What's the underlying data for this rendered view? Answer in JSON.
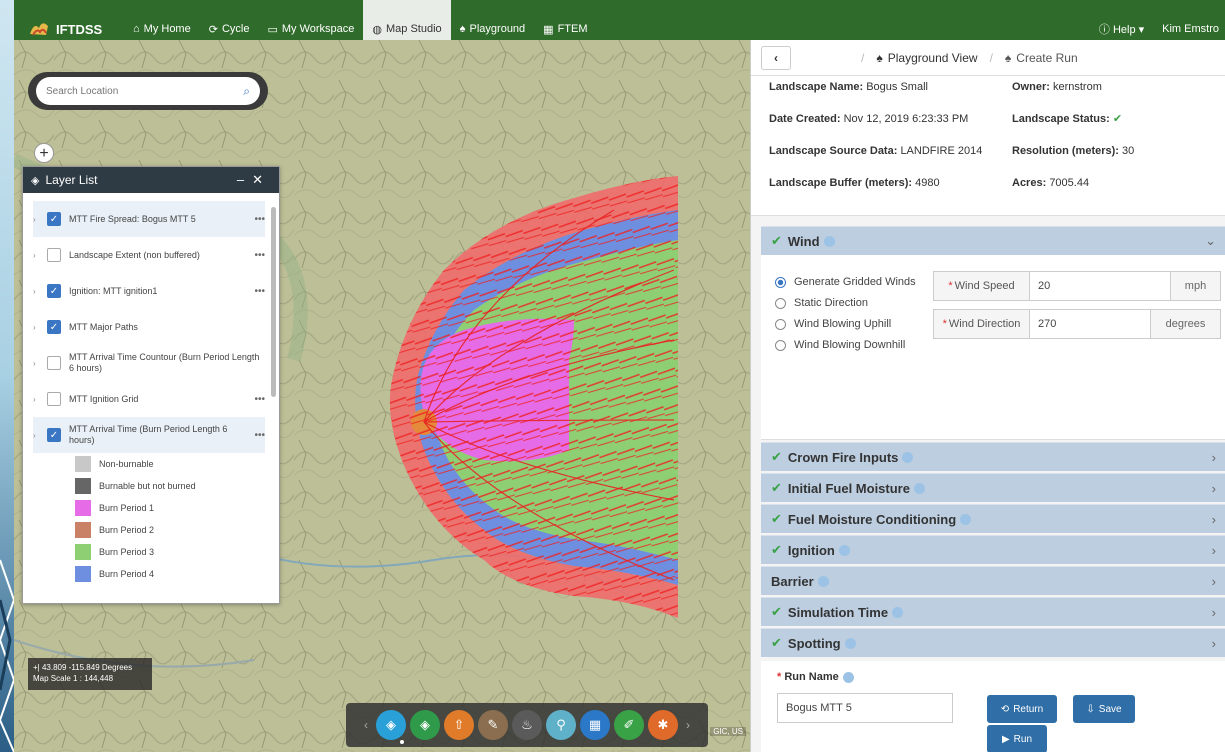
{
  "nav": {
    "brand": "IFTDSS",
    "items": [
      {
        "label": "My Home",
        "icon": "home-icon",
        "glyph": "⌂"
      },
      {
        "label": "Cycle",
        "icon": "cycle-icon",
        "glyph": "⟳"
      },
      {
        "label": "My Workspace",
        "icon": "workspace-icon",
        "glyph": "▭"
      },
      {
        "label": "Map Studio",
        "icon": "globe-icon",
        "glyph": "◍"
      },
      {
        "label": "Playground",
        "icon": "playground-icon",
        "glyph": "♠"
      },
      {
        "label": "FTEM",
        "icon": "ftem-icon",
        "glyph": "▦"
      }
    ],
    "active_index": 3,
    "help": "Help ▾",
    "user": "Kim Emstro"
  },
  "map": {
    "search_placeholder": "Search Location",
    "coords": "+| 43.809 -115.849 Degrees",
    "scale": "Map Scale 1 : 144,448",
    "attribution": "GIC, US"
  },
  "layer_list": {
    "title": "Layer List",
    "layers": [
      {
        "name": "MTT Fire Spread: Bogus MTT 5",
        "checked": true,
        "more": true,
        "selected": true
      },
      {
        "name": "Landscape Extent (non buffered)",
        "checked": false,
        "more": true
      },
      {
        "name": "Ignition: MTT ignition1",
        "checked": true,
        "more": true
      },
      {
        "name": "MTT Major Paths",
        "checked": true,
        "more": false
      },
      {
        "name": "MTT Arrival Time Countour (Burn Period Length 6 hours)",
        "checked": false,
        "more": false
      },
      {
        "name": "MTT Ignition Grid",
        "checked": false,
        "more": true
      },
      {
        "name": "MTT Arrival Time (Burn Period Length 6 hours)",
        "checked": true,
        "more": true,
        "selected": true
      }
    ],
    "legend": [
      {
        "label": "Non-burnable",
        "color": "#c8c8c8"
      },
      {
        "label": "Burnable but not burned",
        "color": "#666666"
      },
      {
        "label": "Burn Period 1",
        "color": "#e66be6"
      },
      {
        "label": "Burn Period 2",
        "color": "#c98266"
      },
      {
        "label": "Burn Period 3",
        "color": "#8fcf74"
      },
      {
        "label": "Burn Period 4",
        "color": "#6e8fe0"
      }
    ]
  },
  "toolbar": {
    "buttons": [
      {
        "icon": "layers-icon",
        "color": "#2aa0d8",
        "glyph": "◈"
      },
      {
        "icon": "basemap-icon",
        "color": "#2f9b4a",
        "glyph": "◈"
      },
      {
        "icon": "upload-icon",
        "color": "#e07b2a",
        "glyph": "⇧"
      },
      {
        "icon": "measure-icon",
        "color": "#8a6e4f",
        "glyph": "✎"
      },
      {
        "icon": "fire-icon",
        "color": "#5a5a5a",
        "glyph": "♨"
      },
      {
        "icon": "location-icon",
        "color": "#5fb0c9",
        "glyph": "⚲"
      },
      {
        "icon": "grid-icon",
        "color": "#2b78c9",
        "glyph": "▦"
      },
      {
        "icon": "draw-icon",
        "color": "#3aa246",
        "glyph": "✐"
      },
      {
        "icon": "settings-icon",
        "color": "#e06a2a",
        "glyph": "✱"
      }
    ]
  },
  "right": {
    "tabs": [
      {
        "label": "Playground View",
        "icon": "playground-icon"
      },
      {
        "label": "Create Run",
        "icon": "run-icon"
      }
    ],
    "meta": [
      {
        "label": "Landscape Name:",
        "value": "Bogus Small"
      },
      {
        "label": "Owner:",
        "value": "kernstrom"
      },
      {
        "label": "Date Created:",
        "value": "Nov 12, 2019 6:23:33 PM"
      },
      {
        "label": "Landscape Status:",
        "value": "✔"
      },
      {
        "label": "Landscape Source Data:",
        "value": "LANDFIRE 2014"
      },
      {
        "label": "Resolution (meters):",
        "value": "30"
      },
      {
        "label": "Landscape Buffer (meters):",
        "value": "4980"
      },
      {
        "label": "Acres:",
        "value": "7005.44"
      }
    ],
    "wind": {
      "title": "Wind",
      "options": [
        "Generate Gridded Winds",
        "Static Direction",
        "Wind Blowing Uphill",
        "Wind Blowing Downhill"
      ],
      "selected": 0,
      "speed_label": "Wind Speed",
      "speed_value": "20",
      "speed_unit": "mph",
      "dir_label": "Wind Direction",
      "dir_value": "270",
      "dir_unit": "degrees"
    },
    "sections": [
      {
        "title": "Crown Fire Inputs",
        "check": true
      },
      {
        "title": "Initial Fuel Moisture",
        "check": true
      },
      {
        "title": "Fuel Moisture Conditioning",
        "check": true
      },
      {
        "title": "Ignition",
        "check": true
      },
      {
        "title": "Barrier",
        "check": false
      },
      {
        "title": "Simulation Time",
        "check": true
      },
      {
        "title": "Spotting",
        "check": true
      }
    ],
    "run": {
      "label": "Run Name",
      "value": "Bogus MTT 5",
      "return_label": "Return",
      "save_label": "Save",
      "run_label": "Run"
    }
  }
}
